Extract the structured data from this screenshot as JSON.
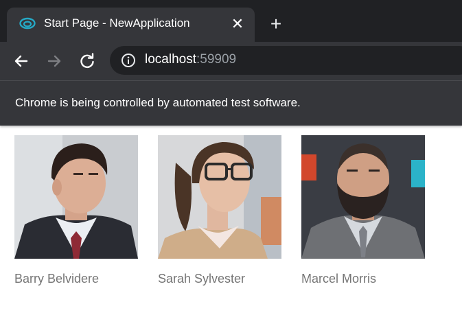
{
  "browser": {
    "tab": {
      "title": "Start Page - NewApplication",
      "favicon": "app-logo-icon",
      "close_icon": "close-icon"
    },
    "new_tab_icon": "plus-icon",
    "toolbar": {
      "back_icon": "back-arrow-icon",
      "forward_icon": "forward-arrow-icon",
      "reload_icon": "reload-icon"
    },
    "address": {
      "info_icon": "info-icon",
      "host": "localhost",
      "port": ":59909"
    },
    "infobar": {
      "message": "Chrome is being controlled by automated test software."
    }
  },
  "people": [
    {
      "name": "Barry Belvidere",
      "photo": "portrait-man-suit-red-tie"
    },
    {
      "name": "Sarah Sylvester",
      "photo": "portrait-woman-glasses"
    },
    {
      "name": "Marcel Morris",
      "photo": "portrait-man-beard-grey-suit"
    }
  ],
  "colors": {
    "accent": "#25a9c6",
    "chrome_dark": "#202124",
    "chrome_tab": "#35363a",
    "name_text": "#757575"
  }
}
